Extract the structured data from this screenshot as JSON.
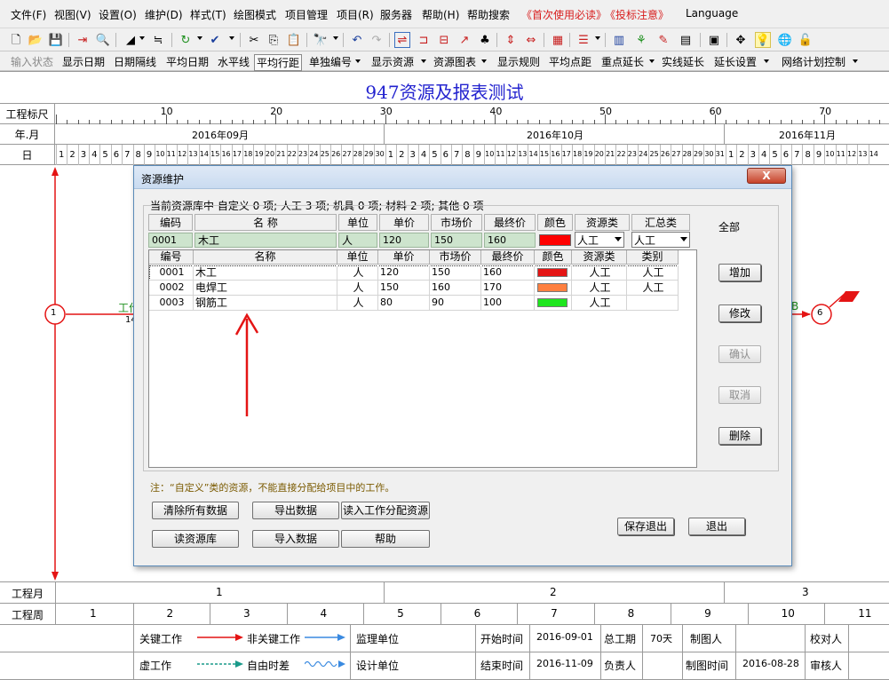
{
  "menu": [
    "文件(F)",
    "视图(V)",
    "设置(O)",
    "维护(D)",
    "样式(T)",
    "绘图模式",
    "项目管理",
    "项目(R)",
    "服务器",
    "帮助(H)",
    "帮助搜索"
  ],
  "menu_red": [
    "《首次使用必读》",
    "《投标注意》"
  ],
  "menu_lang": "Language",
  "toolbar2": [
    "输入状态",
    "显示日期",
    "日期隔线",
    "平均日期",
    "水平线",
    "平均行距",
    "单独编号",
    "显示资源",
    "资源图表",
    "显示规则",
    "平均点距",
    "重点延长",
    "实线延长",
    "延长设置",
    "网络计划控制"
  ],
  "title": "947资源及报表测试",
  "scale": {
    "row1_label": "工程标尺",
    "row2_label": "年.月",
    "row3_label": "日",
    "ticks": [
      "10",
      "20",
      "30",
      "40",
      "50",
      "60",
      "70"
    ],
    "months": [
      "2016年09月",
      "2016年10月",
      "2016年11月"
    ],
    "sep_days": [
      "1",
      "2",
      "3",
      "4",
      "5",
      "6",
      "7",
      "8",
      "9",
      "10",
      "11",
      "12",
      "13",
      "14",
      "15",
      "16",
      "17",
      "18",
      "19",
      "20",
      "21",
      "22",
      "23",
      "24",
      "25",
      "26",
      "27",
      "28",
      "29",
      "30"
    ],
    "oct_days": [
      "1",
      "2",
      "3",
      "4",
      "5",
      "6",
      "7",
      "8",
      "9",
      "10",
      "11",
      "12",
      "13",
      "14",
      "15",
      "16",
      "17",
      "18",
      "19",
      "20",
      "21",
      "22",
      "23",
      "24",
      "25",
      "26",
      "27",
      "28",
      "29",
      "30",
      "31"
    ],
    "nov_days": [
      "1",
      "2",
      "3",
      "4",
      "5",
      "6",
      "7",
      "8",
      "9",
      "10",
      "11",
      "12",
      "13",
      "14"
    ]
  },
  "network": {
    "node_left": "1",
    "node_right": "6",
    "work_label": "工作",
    "work_num": "14",
    "right_label": "B"
  },
  "bottom": {
    "month_label": "工程月",
    "months": [
      "1",
      "2",
      "3"
    ],
    "week_label": "工程周",
    "weeks": [
      "1",
      "2",
      "3",
      "4",
      "5",
      "6",
      "7",
      "8",
      "9",
      "10",
      "11"
    ],
    "legend_critical": "关键工作",
    "legend_noncritical": "非关键工作",
    "legend_dummy": "虚工作",
    "legend_float": "自由时差",
    "supervise": "监理单位",
    "design": "设计单位",
    "start_label": "开始时间",
    "start_val": "2016-09-01",
    "total_label": "总工期",
    "total_val": "70天",
    "maker_label": "制图人",
    "checker_label": "校对人",
    "end_label": "结束时间",
    "end_val": "2016-11-09",
    "owner_label": "负责人",
    "make_time_label": "制图时间",
    "make_time_val": "2016-08-28",
    "auditor_label": "审核人"
  },
  "dialog": {
    "title": "资源维护",
    "close": "X",
    "summary": "当前资源库中 自定义 0 项; 人工 3 项; 机具 0 项; 材料 2 项; 其他 0 项",
    "editor_headers": {
      "code": "编码",
      "name": "名   称",
      "unit": "单位",
      "price": "单价",
      "market": "市场价",
      "final": "最终价",
      "color": "颜色",
      "rtype": "资源类",
      "sum": "汇总类"
    },
    "editor": {
      "code": "0001",
      "name": "木工",
      "unit": "人",
      "price": "120",
      "market": "150",
      "final": "160",
      "color": "#ff0000",
      "rtype": "人工",
      "sum": "人工"
    },
    "list_headers": [
      "编号",
      "名称",
      "单位",
      "单价",
      "市场价",
      "最终价",
      "颜色",
      "资源类",
      "类别"
    ],
    "rows": [
      {
        "code": "0001",
        "name": "木工",
        "unit": "人",
        "price": "120",
        "market": "150",
        "final": "160",
        "color": "#e41414",
        "rtype": "人工",
        "cat": "人工"
      },
      {
        "code": "0002",
        "name": "电焊工",
        "unit": "人",
        "price": "150",
        "market": "160",
        "final": "170",
        "color": "#ff8040",
        "rtype": "人工",
        "cat": "人工"
      },
      {
        "code": "0003",
        "name": "钢筋工",
        "unit": "人",
        "price": "80",
        "market": "90",
        "final": "100",
        "color": "#1ee61e",
        "rtype": "人工",
        "cat": ""
      }
    ],
    "all": "全部",
    "side_buttons": [
      "增加",
      "修改",
      "确认",
      "取消",
      "删除"
    ],
    "note": "注：“自定义”类的资源，不能直接分配给项目中的工作。",
    "bottom_buttons": [
      "清除所有数据",
      "导出数据",
      "读入工作分配资源",
      "读资源库",
      "导入数据",
      "帮助"
    ],
    "save_exit": "保存退出",
    "exit": "退出"
  }
}
